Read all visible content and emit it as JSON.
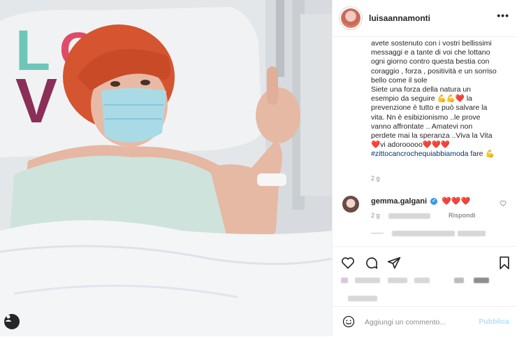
{
  "post": {
    "author": "luisaannamonti",
    "more_label": "•••",
    "caption_text": "avete sostenuto con i vostri bellissimi\nmessaggi e a tante di voi che lottano\nogni giorno contro questa bestia con\ncoraggio , forza , positività e un sorriso\nbello come il sole\nSiete una forza della natura un\nesempio da seguire 💪💪❤️ la\nprevenzione è tutto e può salvare la\nvita. Nn è esibizionismo ..le prove\nvanno affrontate .. Amatevi non\nperdete mai la speranza ..Viva la Vita\n❤️vi adorooooo❤️❤️❤️\n",
    "hashtag": "#zittocancrochequiabbiamoda",
    "hashtag_suffix": " fare 💪",
    "time_ago": "2 g"
  },
  "comment": {
    "user": "gemma.galgani",
    "verified_mark": "✓",
    "text": "❤️❤️❤️",
    "time_ago": "2 g",
    "reply_label": "Rispondi",
    "like_icon": "heart-outline-icon"
  },
  "photo": {
    "pillow_text": "LOVE",
    "description_icon": "user-tag-icon"
  },
  "actions": {
    "like_icon": "heart-icon",
    "comment_icon": "comment-icon",
    "share_icon": "share-icon",
    "save_icon": "bookmark-icon"
  },
  "composer": {
    "placeholder": "Aggiungi un commento...",
    "publish_label": "Pubblica",
    "emoji_icon": "emoji-icon"
  },
  "colors": {
    "link": "#00376b",
    "muted": "#8e8e8e",
    "heart": "#ed4956",
    "publish_disabled": "#b2dffc"
  }
}
